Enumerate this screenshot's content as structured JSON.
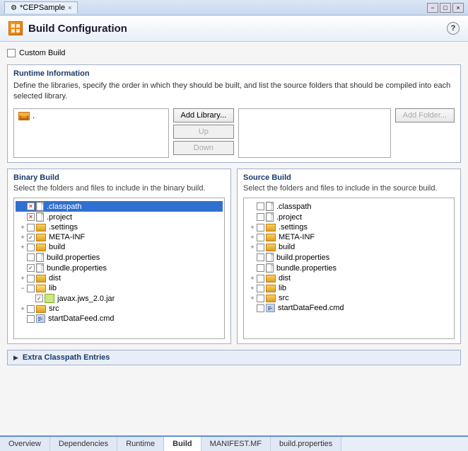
{
  "titleBar": {
    "tab_label": "*CEPSample",
    "close_label": "×",
    "minimize_label": "−",
    "maximize_label": "□"
  },
  "header": {
    "title": "Build Configuration",
    "help_label": "?"
  },
  "customBuild": {
    "label": "Custom Build"
  },
  "runtimeInfo": {
    "title": "Runtime Information",
    "description": "Define the libraries, specify the order in which they should be built, and list the source folders that should be compiled into each selected library.",
    "addLibraryBtn": "Add Library...",
    "upBtn": "Up",
    "downBtn": "Down",
    "addFolderBtn": "Add Folder...",
    "libraryItem": "."
  },
  "binaryBuild": {
    "title": "Binary Build",
    "description": "Select the folders and files to include in the binary build.",
    "items": [
      {
        "indent": 0,
        "expand": " ",
        "cb": "x",
        "icon": "file",
        "label": ".classpath",
        "selected": true
      },
      {
        "indent": 0,
        "expand": " ",
        "cb": "x",
        "icon": "file",
        "label": ".project",
        "selected": false
      },
      {
        "indent": 0,
        "expand": "+",
        "cb": "none",
        "icon": "folder",
        "label": ".settings",
        "selected": false
      },
      {
        "indent": 0,
        "expand": "+",
        "cb": "checked",
        "icon": "folder",
        "label": "META-INF",
        "selected": false
      },
      {
        "indent": 0,
        "expand": "+",
        "cb": "none",
        "icon": "folder",
        "label": "build",
        "selected": false
      },
      {
        "indent": 0,
        "expand": " ",
        "cb": "none",
        "icon": "file",
        "label": "build.properties",
        "selected": false
      },
      {
        "indent": 0,
        "expand": " ",
        "cb": "checked",
        "icon": "file",
        "label": "bundle.properties",
        "selected": false
      },
      {
        "indent": 0,
        "expand": "+",
        "cb": "none",
        "icon": "folder",
        "label": "dist",
        "selected": false
      },
      {
        "indent": 0,
        "expand": "-",
        "cb": "none",
        "icon": "folder-open",
        "label": "lib",
        "selected": false
      },
      {
        "indent": 1,
        "expand": " ",
        "cb": "checked",
        "icon": "jar",
        "label": "javax.jws_2.0.jar",
        "selected": false
      },
      {
        "indent": 0,
        "expand": "+",
        "cb": "none",
        "icon": "folder",
        "label": "src",
        "selected": false
      },
      {
        "indent": 0,
        "expand": " ",
        "cb": "none",
        "icon": "cmd",
        "label": "startDataFeed.cmd",
        "selected": false
      }
    ]
  },
  "sourceBuild": {
    "title": "Source Build",
    "description": "Select the folders and files to include in the source build.",
    "items": [
      {
        "indent": 0,
        "expand": " ",
        "cb": "none",
        "icon": "file",
        "label": ".classpath",
        "selected": false
      },
      {
        "indent": 0,
        "expand": " ",
        "cb": "none",
        "icon": "file",
        "label": ".project",
        "selected": false
      },
      {
        "indent": 0,
        "expand": "+",
        "cb": "none",
        "icon": "folder",
        "label": ".settings",
        "selected": false
      },
      {
        "indent": 0,
        "expand": "+",
        "cb": "none",
        "icon": "folder",
        "label": "META-INF",
        "selected": false
      },
      {
        "indent": 0,
        "expand": "+",
        "cb": "none",
        "icon": "folder",
        "label": "build",
        "selected": false
      },
      {
        "indent": 0,
        "expand": " ",
        "cb": "none",
        "icon": "file",
        "label": "build.properties",
        "selected": false
      },
      {
        "indent": 0,
        "expand": " ",
        "cb": "none",
        "icon": "file",
        "label": "bundle.properties",
        "selected": false
      },
      {
        "indent": 0,
        "expand": "+",
        "cb": "none",
        "icon": "folder",
        "label": "dist",
        "selected": false
      },
      {
        "indent": 0,
        "expand": "+",
        "cb": "none",
        "icon": "folder",
        "label": "lib",
        "selected": false
      },
      {
        "indent": 0,
        "expand": "+",
        "cb": "none",
        "icon": "folder",
        "label": "src",
        "selected": false
      },
      {
        "indent": 0,
        "expand": " ",
        "cb": "none",
        "icon": "cmd",
        "label": "startDataFeed.cmd",
        "selected": false
      }
    ]
  },
  "extraClasspath": {
    "title": "Extra Classpath Entries"
  },
  "bottomTabs": [
    {
      "label": "Overview",
      "active": false
    },
    {
      "label": "Dependencies",
      "active": false
    },
    {
      "label": "Runtime",
      "active": false
    },
    {
      "label": "Build",
      "active": true
    },
    {
      "label": "MANIFEST.MF",
      "active": false
    },
    {
      "label": "build.properties",
      "active": false
    }
  ]
}
